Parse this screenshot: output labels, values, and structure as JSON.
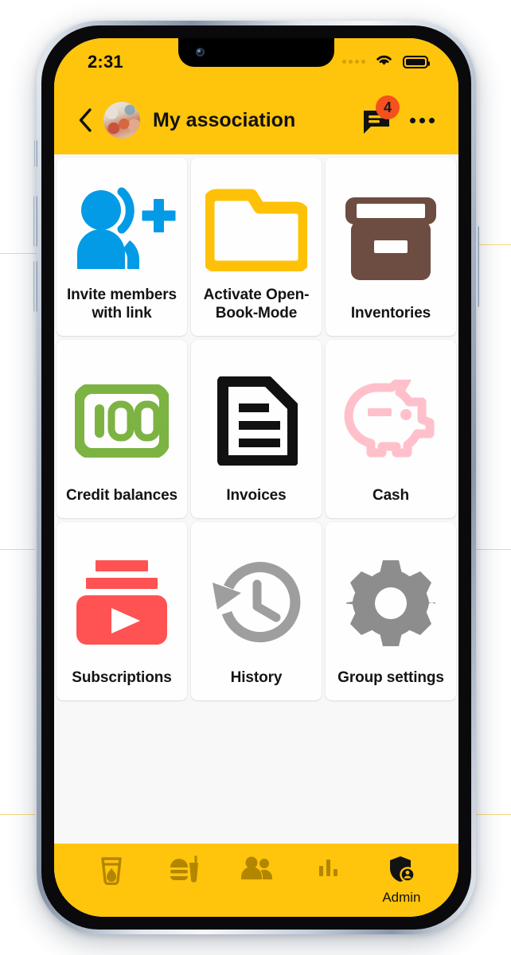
{
  "statusbar": {
    "time": "2:31",
    "signal_icon": "signal-dots-icon",
    "wifi_icon": "wifi-icon",
    "battery_icon": "battery-full-icon"
  },
  "header": {
    "back_icon": "back-chevron-icon",
    "avatar_icon": "group-avatar-photo",
    "title": "My association",
    "chat_icon": "chat-bubble-icon",
    "chat_badge_count": "4",
    "more_icon": "more-horizontal-icon",
    "background_color": "#FFC40C"
  },
  "grid": {
    "tiles": [
      {
        "label": "Invite members with link",
        "icon": "person-add-icon",
        "color": "#039BE5"
      },
      {
        "label": "Activate Open-Book-Mode",
        "icon": "folder-open-icon",
        "color": "#FFC107"
      },
      {
        "label": "Inventories",
        "icon": "archive-box-icon",
        "color": "#6D4C41"
      },
      {
        "label": "Credit balances",
        "icon": "banknote-100-icon",
        "color": "#7CB342"
      },
      {
        "label": "Invoices",
        "icon": "document-text-icon",
        "color": "#111111"
      },
      {
        "label": "Cash",
        "icon": "piggy-bank-icon",
        "color": "#FFC0CB"
      },
      {
        "label": "Subscriptions",
        "icon": "video-stack-icon",
        "color": "#FF5252"
      },
      {
        "label": "History",
        "icon": "history-clock-icon",
        "color": "#9E9E9E"
      },
      {
        "label": "Group settings",
        "icon": "gear-icon",
        "color": "#8D8D8D"
      }
    ]
  },
  "bottomnav": {
    "background_color": "#FFC40C",
    "items": [
      {
        "icon": "drink-glass-icon",
        "label": "",
        "active": false
      },
      {
        "icon": "fast-food-icon",
        "label": "",
        "active": false
      },
      {
        "icon": "people-icon",
        "label": "",
        "active": false
      },
      {
        "icon": "bar-chart-icon",
        "label": "",
        "active": false
      },
      {
        "icon": "admin-shield-icon",
        "label": "Admin",
        "active": true
      }
    ]
  }
}
